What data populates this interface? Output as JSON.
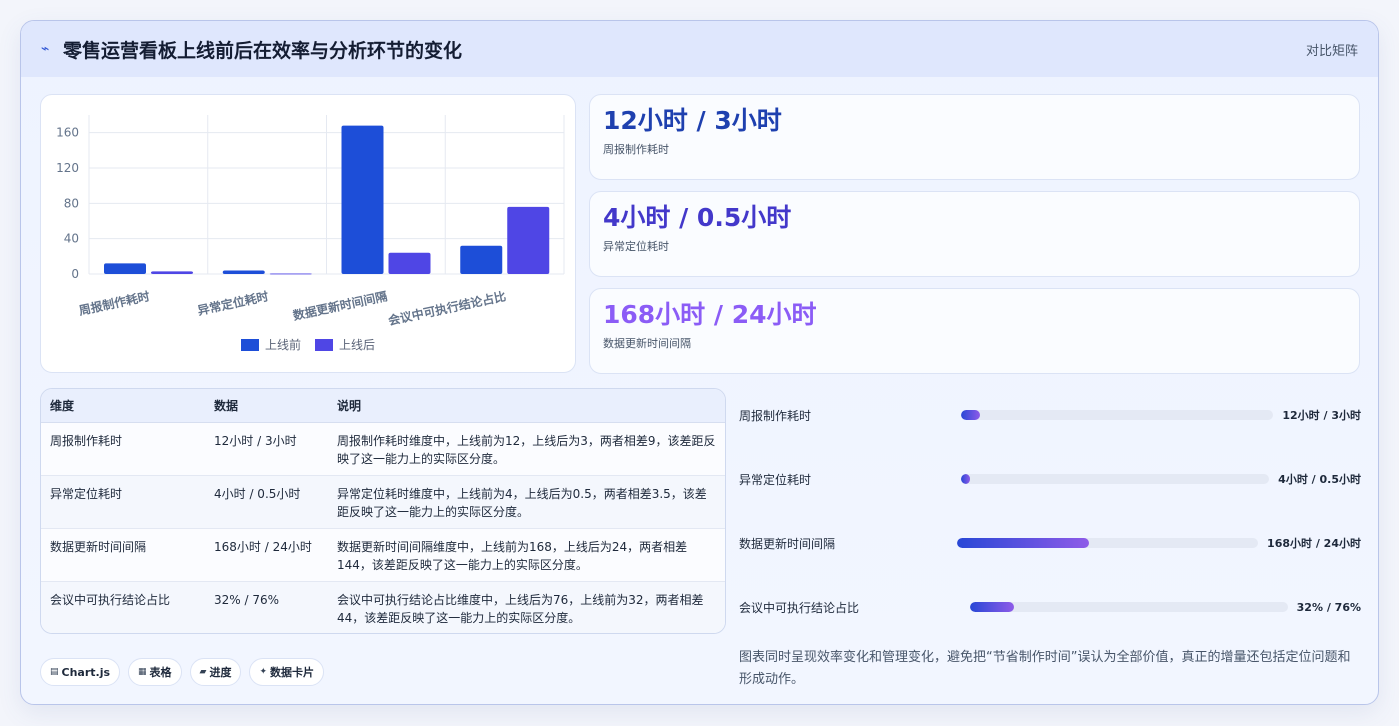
{
  "header": {
    "title": "零售运营看板上线前后在效率与分析环节的变化",
    "tag": "对比矩阵",
    "icon": "bolt-icon"
  },
  "colors": {
    "before": "#1d4ed8",
    "after": "#4f46e5",
    "kpi1": "#1e40af",
    "kpi2": "#4338ca",
    "kpi3": "#8b5cf6"
  },
  "chart_data": {
    "type": "bar",
    "categories": [
      "周报制作耗时",
      "异常定位耗时",
      "数据更新时间间隔",
      "会议中可执行结论占比"
    ],
    "series": [
      {
        "name": "上线前",
        "values": [
          12,
          4,
          168,
          32
        ]
      },
      {
        "name": "上线后",
        "values": [
          3,
          0.5,
          24,
          76
        ]
      }
    ],
    "yticks": [
      "0",
      "40",
      "80",
      "120",
      "160"
    ],
    "ylim": [
      0,
      180
    ],
    "grid": true,
    "legend_position": "bottom"
  },
  "kpis": [
    {
      "value": "12小时 / 3小时",
      "label": "周报制作耗时"
    },
    {
      "value": "4小时 / 0.5小时",
      "label": "异常定位耗时"
    },
    {
      "value": "168小时 / 24小时",
      "label": "数据更新时间间隔"
    }
  ],
  "table": {
    "headers": [
      "维度",
      "数据",
      "说明"
    ],
    "rows": [
      {
        "dim": "周报制作耗时",
        "data": "12小时 / 3小时",
        "desc": "周报制作耗时维度中，上线前为12，上线后为3，两者相差9，该差距反映了这一能力上的实际区分度。"
      },
      {
        "dim": "异常定位耗时",
        "data": "4小时 / 0.5小时",
        "desc": "异常定位耗时维度中，上线前为4，上线后为0.5，两者相差3.5，该差距反映了这一能力上的实际区分度。"
      },
      {
        "dim": "数据更新时间间隔",
        "data": "168小时 / 24小时",
        "desc": "数据更新时间间隔维度中，上线前为168，上线后为24，两者相差144，该差距反映了这一能力上的实际区分度。"
      },
      {
        "dim": "会议中可执行结论占比",
        "data": "32% / 76%",
        "desc": "会议中可执行结论占比维度中，上线后为76，上线前为32，两者相差44，该差距反映了这一能力上的实际区分度。"
      }
    ]
  },
  "progress": [
    {
      "label": "周报制作耗时",
      "value": "12小时 / 3小时",
      "fill_fraction": 0.06
    },
    {
      "label": "异常定位耗时",
      "value": "4小时 / 0.5小时",
      "fill_fraction": 0.03
    },
    {
      "label": "数据更新时间间隔",
      "value": "168小时 / 24小时",
      "fill_fraction": 0.44
    },
    {
      "label": "会议中可执行结论占比",
      "value": "32% / 76%",
      "fill_fraction": 0.14
    }
  ],
  "note": "图表同时呈现效率变化和管理变化，避免把“节省制作时间”误认为全部价值，真正的增量还包括定位问题和形成动作。",
  "tags": [
    {
      "icon": "chart-icon",
      "label": "Chart.js"
    },
    {
      "icon": "table-icon",
      "label": "表格"
    },
    {
      "icon": "folder-icon",
      "label": "进度"
    },
    {
      "icon": "sparkle-icon",
      "label": "数据卡片"
    }
  ]
}
